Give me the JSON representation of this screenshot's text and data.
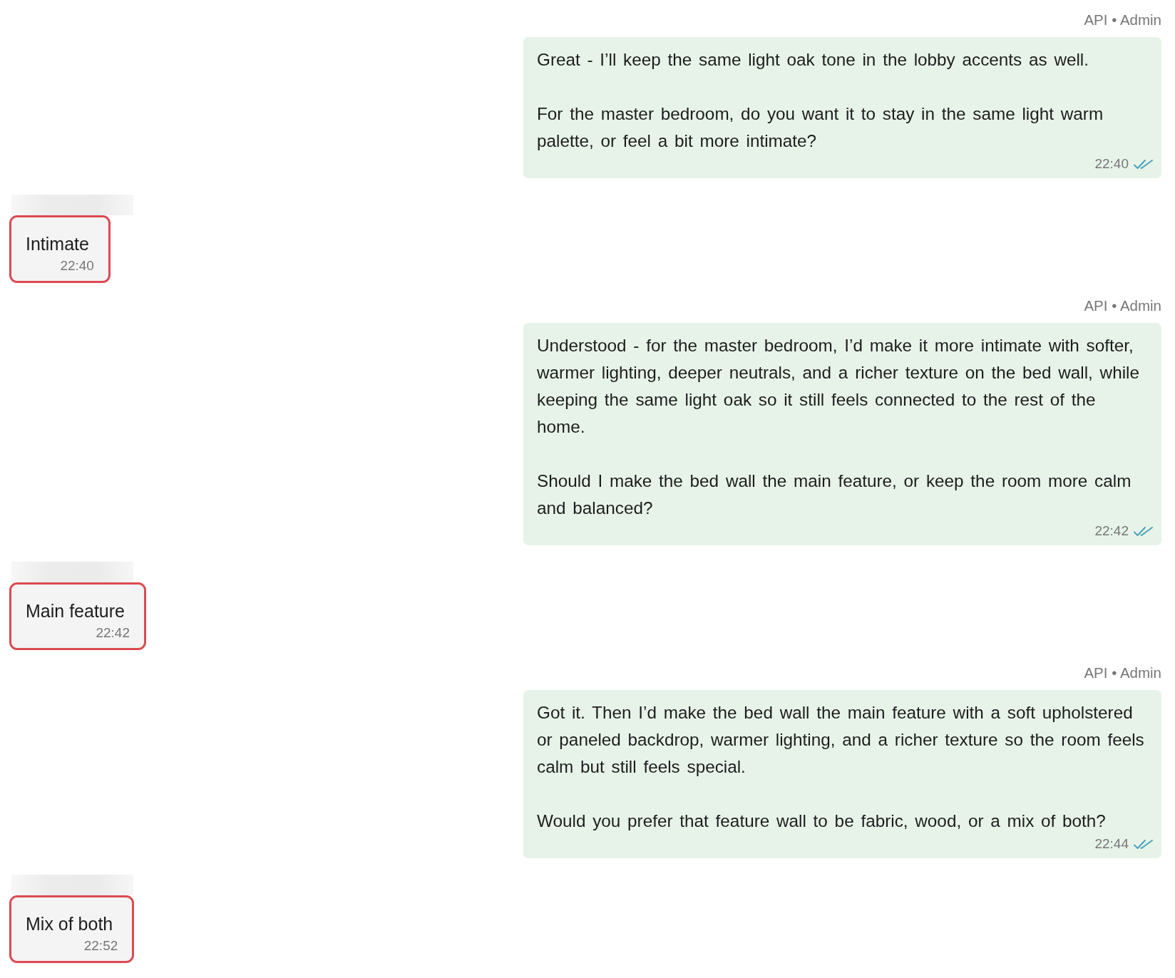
{
  "messages": [
    {
      "kind": "outgoing",
      "sender": "API • Admin",
      "paragraphs": [
        "Great - I’ll keep the same light oak tone in the lobby accents as well.",
        "For the master bedroom, do you want it to stay in the same light warm palette, or feel a bit more intimate?"
      ],
      "time": "22:40",
      "read": true
    },
    {
      "kind": "incoming",
      "text": "Intimate",
      "time": "22:40",
      "highlighted": true
    },
    {
      "kind": "outgoing",
      "sender": "API • Admin",
      "paragraphs": [
        "Understood - for the master bedroom, I’d make it more intimate with softer, warmer lighting, deeper neutrals, and a richer texture on the bed wall, while keeping the same light oak so it still feels connected to the rest of the home.",
        "Should I make the bed wall the main feature, or keep the room more calm and balanced?"
      ],
      "time": "22:42",
      "read": true
    },
    {
      "kind": "incoming",
      "text": "Main feature",
      "time": "22:42",
      "highlighted": true
    },
    {
      "kind": "outgoing",
      "sender": "API • Admin",
      "paragraphs": [
        "Got it. Then I’d make the bed wall the main feature with a soft upholstered or paneled backdrop, warmer lighting, and a richer texture so the room feels calm but still feels special.",
        "Would you prefer that feature wall to be fabric, wood, or a mix of both?"
      ],
      "time": "22:44",
      "read": true
    },
    {
      "kind": "incoming",
      "text": "Mix of both",
      "time": "22:52",
      "highlighted": true
    }
  ]
}
